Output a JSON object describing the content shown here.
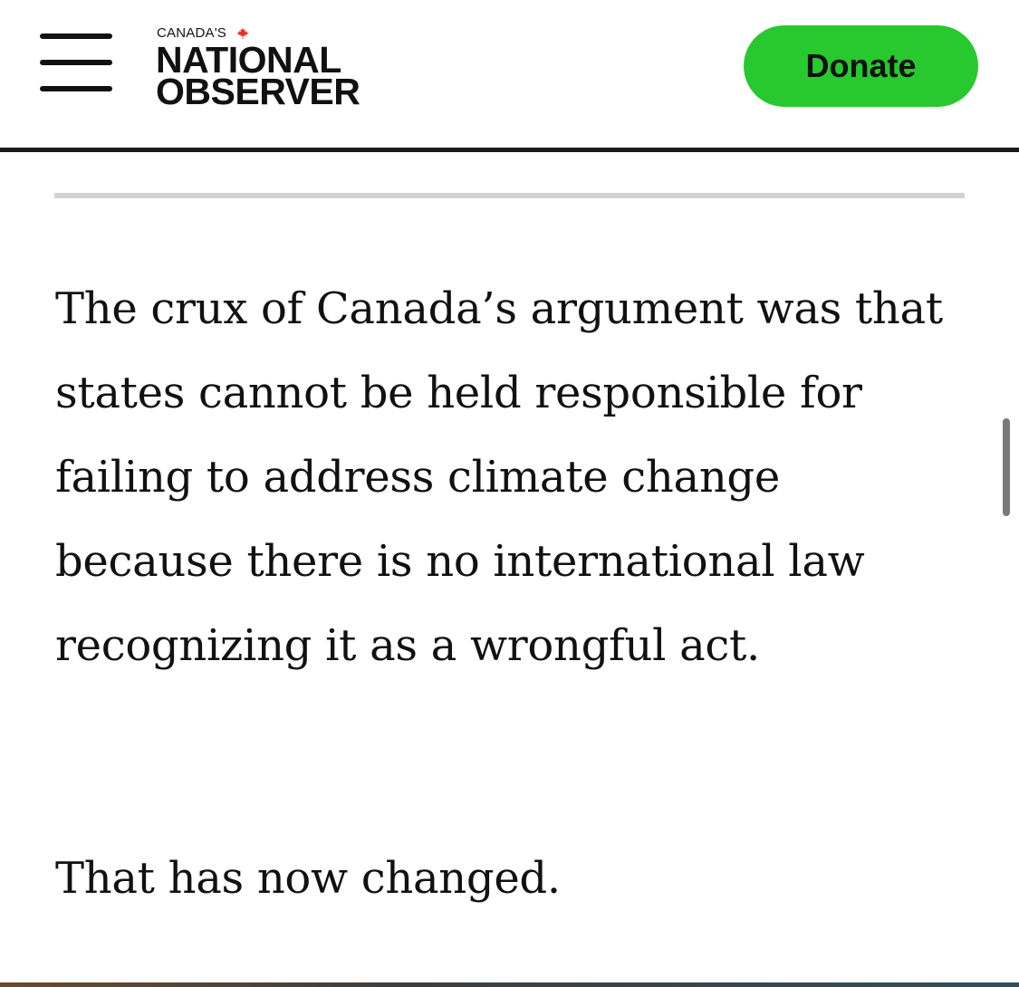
{
  "header": {
    "menu_icon": "hamburger-menu-icon",
    "logo": {
      "small_text": "CANADA'S",
      "line1": "NATIONAL",
      "line2": "OBSERVER",
      "leaf_icon": "maple-leaf-icon"
    },
    "donate_label": "Donate"
  },
  "colors": {
    "donate_bg": "#27c92e",
    "maple_leaf": "#e8332a",
    "divider": "#d2d2d2"
  },
  "article": {
    "paragraphs": [
      "The crux of Canada’s argument was that states cannot be held responsible for failing to address climate change because there is no international law recognizing it as a wrongful act.",
      "That has now changed."
    ]
  }
}
